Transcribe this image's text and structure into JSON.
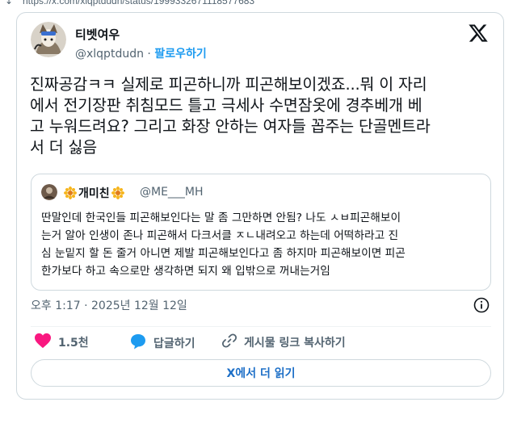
{
  "browser": {
    "arrow": "↓",
    "url": "https://x.com/xlqptdudn/status/1999332671118577683"
  },
  "author": {
    "name": "티벳여우",
    "handle": "@xlqptdudn",
    "separator": "·",
    "follow_label": "팔로우하기"
  },
  "tweet": {
    "lines": [
      "진짜공감ㅋㅋ 실제로 피곤하니까 피곤해보이겠죠...뭐 이 자리",
      "에서 전기장판 취침모드 틀고 극세사 수면잠옷에 경추베개 베",
      "고 누워드려요? 그리고 화장 안하는 여자들 꼽주는 단골멘트라",
      "서 더 싫음"
    ]
  },
  "quote": {
    "name": "개미친",
    "handle": "@ME___MH",
    "lines": [
      "딴말인데 한국인들 피곤해보인다는 말 좀 그만하면 안됨? 나도 ㅅㅂ피곤해보이",
      "는거 알아 인생이 존나 피곤해서 다크서클 ㅈㄴ내려오고 하는데 어떡하라고 진",
      "심 눈밑지 할 돈 줄거 아니면 제발 피곤해보인다고 좀 하지마 피곤해보이면 피곤",
      "한가보다 하고 속으로만 생각하면 되지 왜 입밖으로 꺼내는거임"
    ]
  },
  "timestamp": "오후 1:17 · 2025년 12월 12일",
  "actions": {
    "like_count": "1.5천",
    "reply_label": "답글하기",
    "copy_label": "게시물 링크 복사하기"
  },
  "read_more": "X에서 더 읽기",
  "colors": {
    "accent": "#1d9bf0",
    "like": "#f91880",
    "border": "#cfd9de",
    "secondary_text": "#536471"
  }
}
